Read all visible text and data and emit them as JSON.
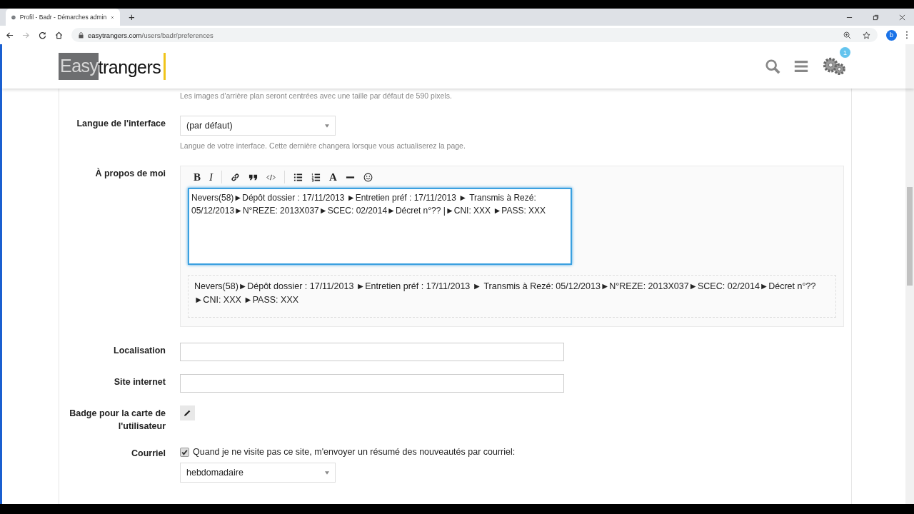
{
  "browser": {
    "tab_title": "Profil - Badr - Démarches admin",
    "new_tab": "+",
    "url_host": "easytrangers.com",
    "url_path": "/users/badr/preferences",
    "profile_initial": "b"
  },
  "header": {
    "logo_left": "Easy",
    "logo_right": "trangers",
    "notification_count": "1"
  },
  "background_hint": "Les images d'arrière plan seront centrées avec une taille par défaut de 590 pixels.",
  "language": {
    "label": "Langue de l'interface",
    "value": "(par défaut)",
    "hint": "Langue de votre interface. Cette dernière changera lorsque vous actualiserez la page."
  },
  "about": {
    "label": "À propos de moi",
    "toolbar": [
      {
        "kind": "bold",
        "text": "B"
      },
      {
        "kind": "italic",
        "text": "I"
      },
      {
        "kind": "sep"
      },
      {
        "kind": "link"
      },
      {
        "kind": "quote"
      },
      {
        "kind": "code"
      },
      {
        "kind": "sep"
      },
      {
        "kind": "bullets"
      },
      {
        "kind": "numbers"
      },
      {
        "kind": "font",
        "text": "A"
      },
      {
        "kind": "rule"
      },
      {
        "kind": "emoji"
      }
    ],
    "value": "Nevers(58)►Dépôt dossier : 17/11/2013 ►Entretien préf : 17/11/2013  ► Transmis à Rezé: 05/12/2013►N°REZE: 2013X037►SCEC: 02/2014►Décret n°?? |►CNI: XXX ►PASS: XXX",
    "preview": "Nevers(58)►Dépôt dossier : 17/11/2013 ►Entretien préf : 17/11/2013 ► Transmis à Rezé: 05/12/2013►N°REZE: 2013X037►SCEC: 02/2014►Décret n°?? ►CNI: XXX ►PASS: XXX"
  },
  "location": {
    "label": "Localisation"
  },
  "website": {
    "label": "Site internet"
  },
  "badge": {
    "label": "Badge pour la carte de l'utilisateur"
  },
  "email": {
    "label": "Courriel",
    "checked": true,
    "option": "Quand je ne visite pas ce site, m'envoyer un résumé des nouveautés par courriel:",
    "frequency": "hebdomadaire"
  }
}
